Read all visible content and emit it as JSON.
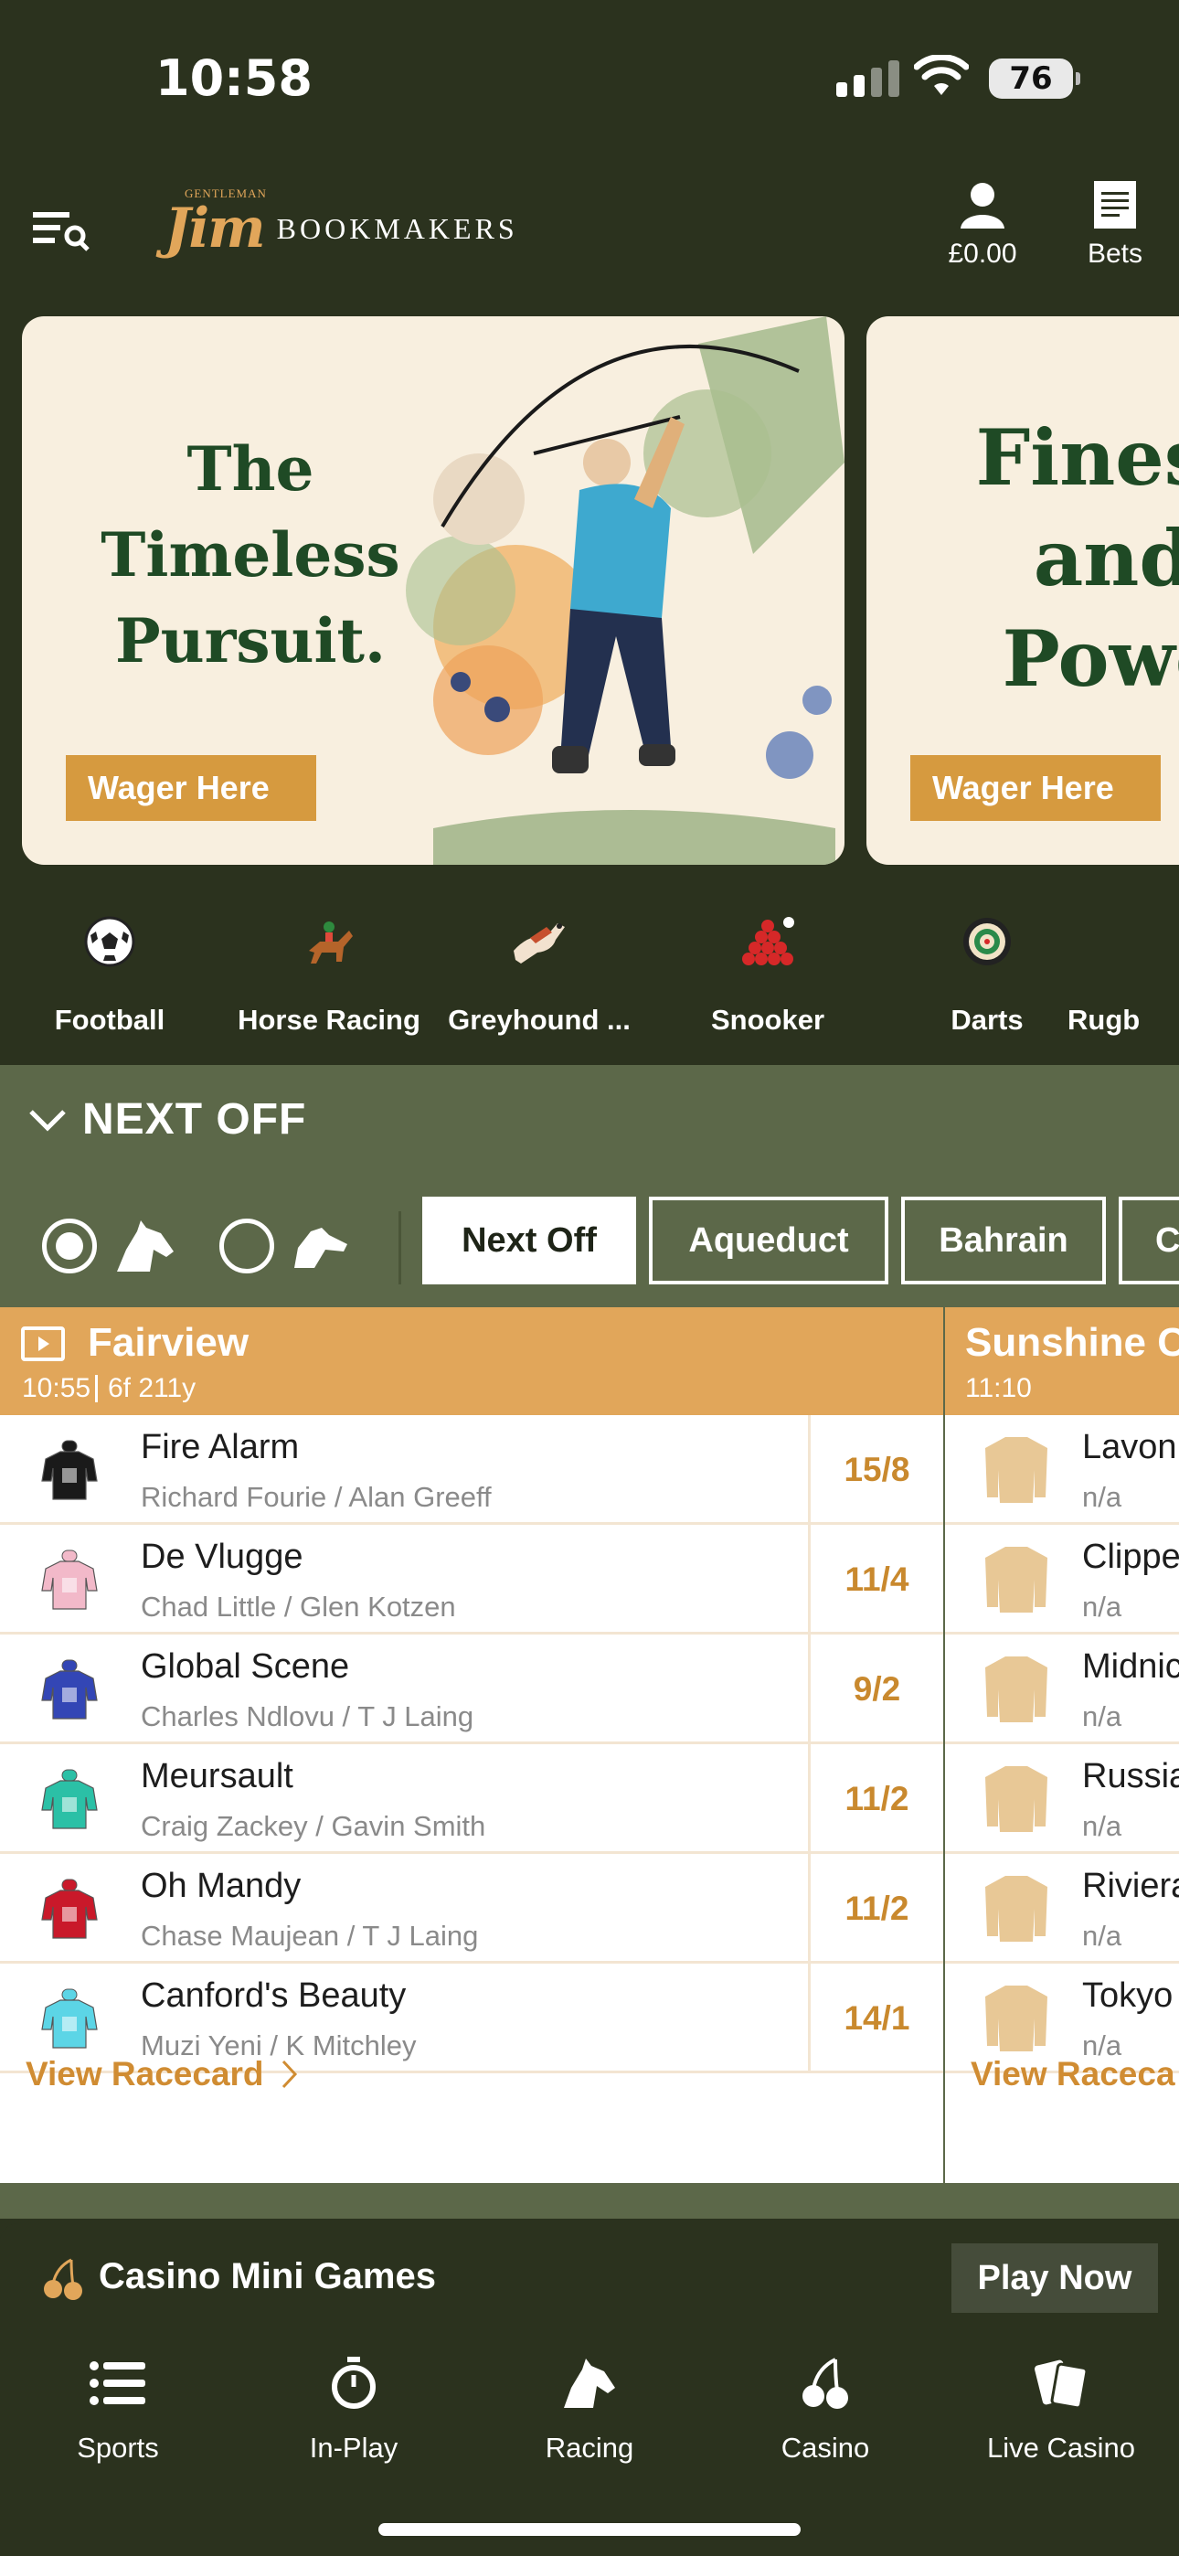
{
  "status_bar": {
    "time": "10:58",
    "battery": "76"
  },
  "header": {
    "logo_small": "GENTLEMAN",
    "logo_script": "Jim",
    "logo_text": "BOOKMAKERS",
    "balance": "£0.00",
    "bets_label": "Bets"
  },
  "banners": [
    {
      "title": "The Timeless Pursuit.",
      "cta": "Wager Here"
    },
    {
      "title": "Finess and Powe",
      "cta": "Wager Here"
    }
  ],
  "sports": [
    {
      "label": "Football",
      "icon": "football-icon"
    },
    {
      "label": "Horse Racing",
      "icon": "horse-racing-icon"
    },
    {
      "label": "Greyhound ...",
      "icon": "greyhound-icon"
    },
    {
      "label": "Snooker",
      "icon": "snooker-icon"
    },
    {
      "label": "Darts",
      "icon": "darts-icon"
    },
    {
      "label": "Rugb",
      "icon": "rugby-icon"
    }
  ],
  "next_off": {
    "title": "NEXT OFF",
    "chips": [
      "Next Off",
      "Aqueduct",
      "Bahrain",
      "C"
    ]
  },
  "race_cards": [
    {
      "venue": "Fairview",
      "time": "10:55",
      "distance": "6f 211y",
      "runners": [
        {
          "name": "Fire Alarm",
          "jockey": "Richard Fourie / Alan Greeff",
          "odds": "15/8",
          "silk": "#1a1a1a"
        },
        {
          "name": "De Vlugge",
          "jockey": "Chad Little / Glen Kotzen",
          "odds": "11/4",
          "silk": "#f2b9c9"
        },
        {
          "name": "Global Scene",
          "jockey": "Charles Ndlovu / T J Laing",
          "odds": "9/2",
          "silk": "#3346b5"
        },
        {
          "name": "Meursault",
          "jockey": "Craig Zackey / Gavin Smith",
          "odds": "11/2",
          "silk": "#2bc0a6"
        },
        {
          "name": "Oh Mandy",
          "jockey": "Chase Maujean / T J Laing",
          "odds": "11/2",
          "silk": "#c9192a"
        },
        {
          "name": "Canford's Beauty",
          "jockey": "Muzi Yeni / K Mitchley",
          "odds": "14/1",
          "silk": "#5cd5e6"
        }
      ],
      "view_label": "View Racecard"
    },
    {
      "venue": "Sunshine C",
      "time": "11:10",
      "runners": [
        {
          "name": "Lavon",
          "jockey": "n/a"
        },
        {
          "name": "Clippe",
          "jockey": "n/a"
        },
        {
          "name": "Midnic",
          "jockey": "n/a"
        },
        {
          "name": "Russia",
          "jockey": "n/a"
        },
        {
          "name": "Riviera",
          "jockey": "n/a"
        },
        {
          "name": "Tokyo",
          "jockey": "n/a"
        }
      ],
      "view_label": "View Raceca"
    }
  ],
  "casino_bar": {
    "title": "Casino Mini Games",
    "cta": "Play Now"
  },
  "bottom_nav": [
    {
      "label": "Sports",
      "icon": "list-icon"
    },
    {
      "label": "In-Play",
      "icon": "stopwatch-icon"
    },
    {
      "label": "Racing",
      "icon": "horse-head-icon"
    },
    {
      "label": "Casino",
      "icon": "cherries-icon"
    },
    {
      "label": "Live Casino",
      "icon": "cards-icon"
    }
  ],
  "colors": {
    "dark": "#2b321e",
    "olive": "#5c6849",
    "gold": "#e1a65a",
    "odds": "#c9892e"
  }
}
